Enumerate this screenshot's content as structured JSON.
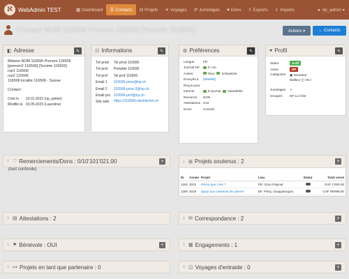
{
  "app": {
    "name": "WebAdmin TEST"
  },
  "nav": [
    {
      "icon": "▦",
      "label": "Dashboard",
      "active": false
    },
    {
      "icon": "☰",
      "label": "Contacts",
      "active": true
    },
    {
      "icon": "⊟",
      "label": "Projets",
      "active": false
    },
    {
      "icon": "✈",
      "label": "Voyages",
      "active": false
    },
    {
      "icon": "⇄",
      "label": "Jumelages",
      "active": false
    },
    {
      "icon": "♥",
      "label": "Dons",
      "active": false
    },
    {
      "icon": "⇪",
      "label": "Exports",
      "active": false
    },
    {
      "icon": "⇩",
      "label": "Imports",
      "active": false
    }
  ],
  "user": {
    "name": "np_admin"
  },
  "page": {
    "title": "Contact NOM 116506 Prenom 116506 [Societe 116506]",
    "actions_label": "Actions ▾",
    "contacts_label": "← Contacts"
  },
  "adresse": {
    "title": "Adresse",
    "lines": [
      "Mdame NOM 116506 Prenom 116506",
      "[prenom2 116506] [Societe 116506]",
      "rue1 116506",
      "rue2 116506",
      "116506 localite 116506 - Suisse"
    ],
    "contact_label": "Contact :",
    "meta": [
      {
        "k": "Créé le",
        "v": "20.01.2022 (np_admin)"
      },
      {
        "k": "Modifié le",
        "v": "03.05.2023 (Laureline)"
      }
    ]
  },
  "informations": {
    "title": "Informations",
    "rows": [
      {
        "k": "Tél privé",
        "v": "Tel privé 116506",
        "link": false
      },
      {
        "k": "Tél prof.",
        "v": "Portable 116506",
        "link": false
      },
      {
        "k": "Tél prof",
        "v": "Tel prof 116506",
        "link": false
      },
      {
        "k": "Email 1",
        "v": "116506-prive@np.ch",
        "link": true
      },
      {
        "k": "Email 2",
        "v": "116506-prive-2@np.ch",
        "link": true
      },
      {
        "k": "Email pro",
        "v": "116506-prof@np.ch",
        "link": true
      },
      {
        "k": "Site web",
        "v": "https://116506-siteinternet.ch",
        "link": true
      }
    ]
  },
  "preferences": {
    "title": "Préférences",
    "rows": [
      {
        "k": "Langue",
        "v": "FR"
      },
      {
        "k": "Journal NP",
        "v": "5 / an",
        "color": "#6aa84f"
      },
      {
        "k": "Autres",
        "v": "Riou",
        "v2": "Schweitzer",
        "color": "#6aa84f",
        "color2": "#6aa84f"
      },
      {
        "k": "Envoyés à",
        "v": "[999999]",
        "link": true
      },
      {
        "k": "Reçus pour",
        "v": ""
      },
      {
        "k": "Internet",
        "v": "E-journal",
        "v2": "Newsletter",
        "color": "#6aa84f",
        "color2": "#6aa84f"
      },
      {
        "k": "Remercis",
        "v": "NON"
      },
      {
        "k": "Attestations",
        "v": "OUI"
      },
      {
        "k": "Envoi",
        "v": "Courriel"
      }
    ]
  },
  "profil": {
    "title": "Profil",
    "statut_label": "Statut",
    "statut": "Actif",
    "statut_color": "#4caf50",
    "assoc_label": "Assoc",
    "assoc": "NP",
    "assoc_color": "#b23a1f",
    "categories_label": "Catégories",
    "categories": [
      "Donateur",
      "Bailleur",
      "VEJ"
    ],
    "jumelages_label": "Jumelages",
    "groupes_label": "Groupes",
    "groupes": "NP La Côte"
  },
  "remerciements": {
    "title": "Remerciements/Dons : 0/10'101'021.00",
    "note": "(tout confondu)"
  },
  "projets": {
    "title": "Projets soutenus : 2",
    "headers": [
      "ID",
      "Année",
      "Projet",
      "Lieu",
      "Statut",
      "Total versé"
    ],
    "rows": [
      {
        "id": "1281",
        "annee": "2021",
        "projet": "Pérou que c'est ?",
        "lieu": "PE, Gran Pajonal",
        "statut_color": "#555",
        "total": "CHF 1'000.00"
      },
      {
        "id": "1188",
        "annee": "2019",
        "projet": "appui aux casseurs de pierres",
        "lieu": "BF, Pissy, Ouagadougou",
        "statut_color": "#555",
        "total": "CHF 99'999.00"
      }
    ]
  },
  "attestations": {
    "title": "Attestations : 2"
  },
  "correspondance": {
    "title": "Correspondance : 2"
  },
  "benevole": {
    "title": "Bénévole : OUI"
  },
  "engagements": {
    "title": "Engagements : 1"
  },
  "partenaire": {
    "title": "Projets en tant que partenaire : 0"
  },
  "voyages": {
    "title": "Voyages d'entraide : 0"
  }
}
